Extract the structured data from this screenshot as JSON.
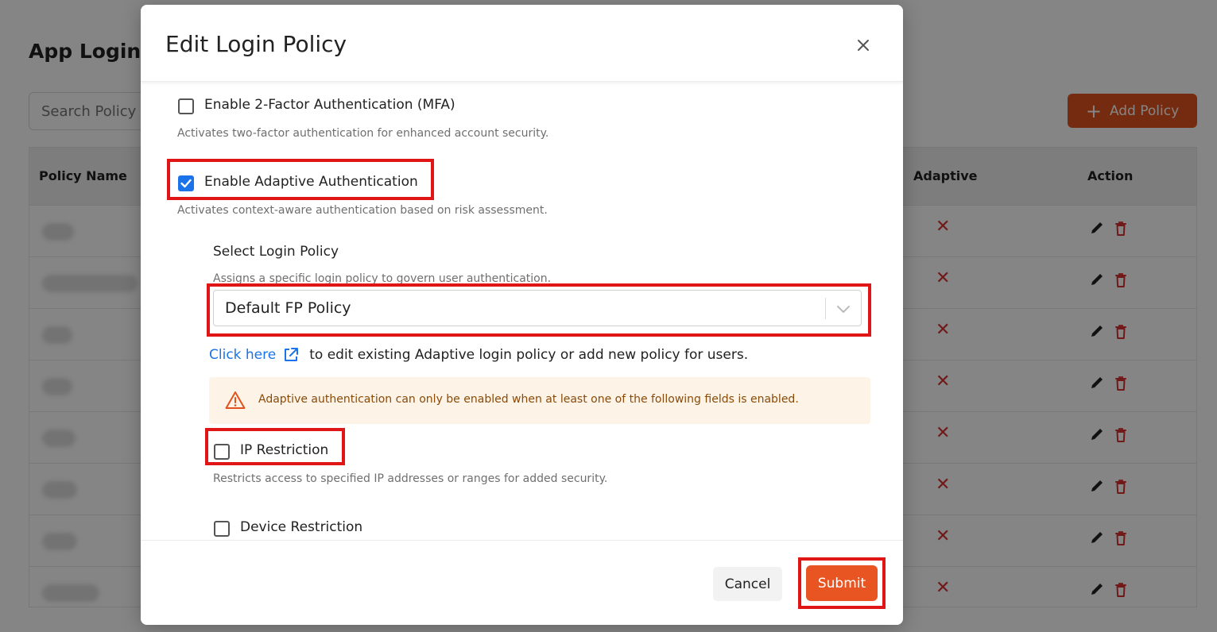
{
  "background": {
    "page_title": "App Login P",
    "search": {
      "placeholder": "Search Policy"
    },
    "add_policy_label": "Add Policy",
    "table": {
      "headers": {
        "policy_name": "Policy Name",
        "adaptive": "Adaptive",
        "action": "Action"
      },
      "row_count": 8,
      "adaptive_value_icon": "x-icon",
      "action_icons": [
        "pencil-icon",
        "trash-icon"
      ]
    }
  },
  "modal": {
    "title": "Edit Login Policy",
    "close_icon": "close-icon",
    "options": {
      "mfa": {
        "label": "Enable 2-Factor Authentication (MFA)",
        "description": "Activates two-factor authentication for enhanced account security.",
        "checked": false
      },
      "adaptive": {
        "label": "Enable Adaptive Authentication",
        "description": "Activates context-aware authentication based on risk assessment.",
        "checked": true
      }
    },
    "login_policy": {
      "label": "Select Login Policy",
      "description": "Assigns a specific login policy to govern user authentication.",
      "selected": "Default FP Policy"
    },
    "link": {
      "text": "Click here",
      "suffix": "to edit existing Adaptive login policy or add new policy for users."
    },
    "alert": {
      "text": "Adaptive authentication can only be enabled when at least one of the following fields is enabled."
    },
    "ip_restriction": {
      "label": "IP Restriction",
      "description": "Restricts access to specified IP addresses or ranges for added security.",
      "checked": false
    },
    "device_restriction": {
      "label": "Device Restriction",
      "checked": false
    },
    "footer": {
      "cancel_label": "Cancel",
      "submit_label": "Submit"
    }
  },
  "colors": {
    "accent": "#e95423",
    "highlight": "#e01515",
    "checkbox_checked": "#1a73e8",
    "link": "#1a73e8",
    "alert_bg": "#fdf3e7",
    "alert_icon": "#e0531f",
    "delete": "#d93030"
  }
}
